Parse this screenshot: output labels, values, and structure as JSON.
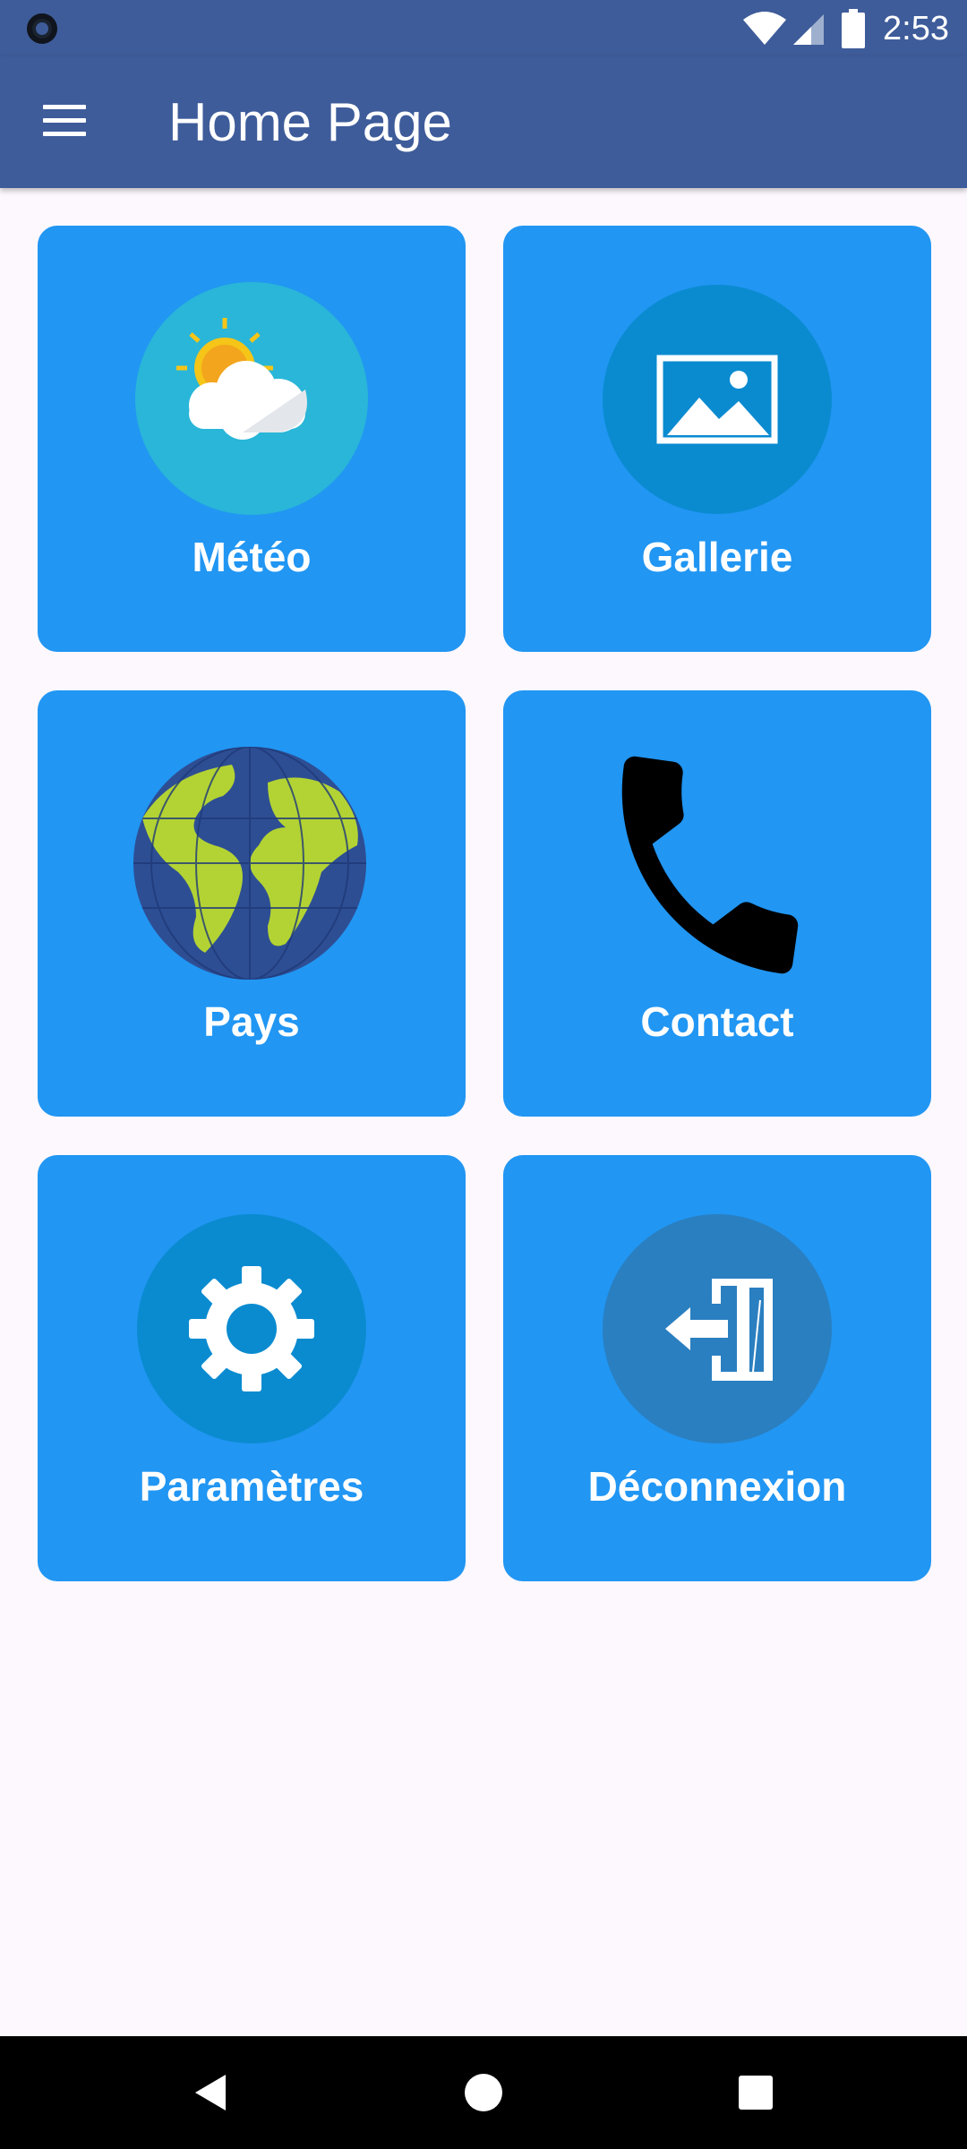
{
  "status_bar": {
    "time": "2:53",
    "icons": [
      "camera-dot-icon",
      "wifi-icon",
      "cell-signal-icon",
      "battery-icon"
    ]
  },
  "app_bar": {
    "title": "Home Page",
    "menu_icon": "hamburger-menu-icon"
  },
  "tiles": [
    {
      "label": "Météo",
      "icon": "weather-sun-cloud-icon"
    },
    {
      "label": "Gallerie",
      "icon": "image-gallery-icon"
    },
    {
      "label": "Pays",
      "icon": "globe-icon"
    },
    {
      "label": "Contact",
      "icon": "phone-icon"
    },
    {
      "label": "Paramètres",
      "icon": "gear-icon"
    },
    {
      "label": "Déconnexion",
      "icon": "logout-door-icon"
    }
  ],
  "colors": {
    "app_bar": "#3e5c9a",
    "tile": "#2196f3",
    "background": "#fcf8fd",
    "nav_bar": "#000000"
  },
  "nav_bar": {
    "buttons": [
      "back-icon",
      "home-icon",
      "recents-icon"
    ]
  }
}
